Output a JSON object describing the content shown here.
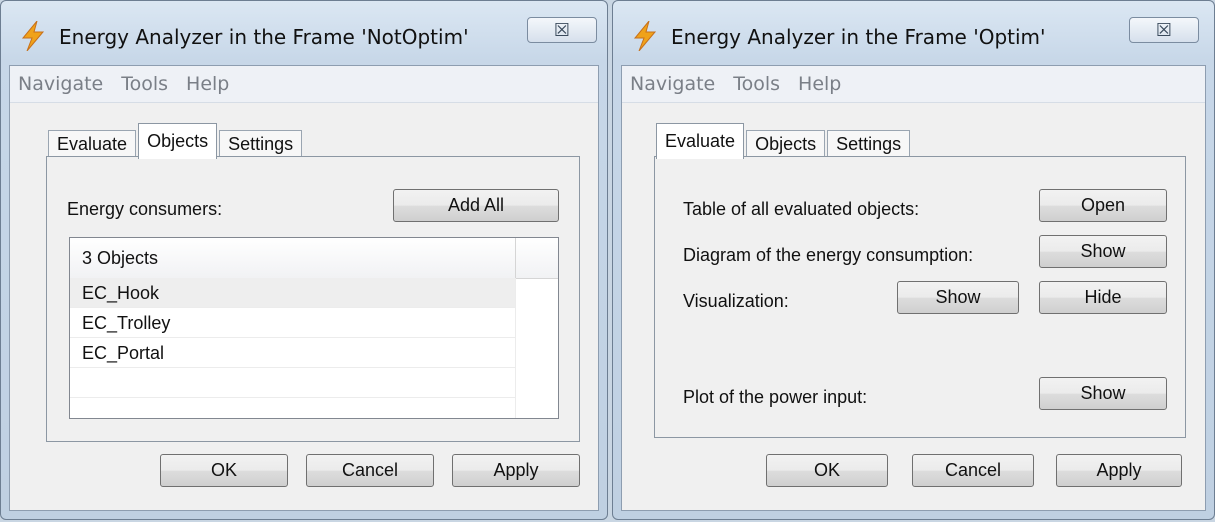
{
  "left_window": {
    "title": "Energy Analyzer in the Frame 'NotOptim'",
    "close_glyph": "☒",
    "menu": [
      "Navigate",
      "Tools",
      "Help"
    ],
    "tabs": [
      "Evaluate",
      "Objects",
      "Settings"
    ],
    "active_tab": "Objects",
    "energy_consumers_label": "Energy consumers:",
    "add_all_label": "Add All",
    "list_header": "3 Objects",
    "list_items": [
      "EC_Hook",
      "EC_Trolley",
      "EC_Portal"
    ],
    "selected_item": "EC_Hook",
    "ok_label": "OK",
    "cancel_label": "Cancel",
    "apply_label": "Apply"
  },
  "right_window": {
    "title": "Energy Analyzer in the Frame 'Optim'",
    "close_glyph": "☒",
    "menu": [
      "Navigate",
      "Tools",
      "Help"
    ],
    "tabs": [
      "Evaluate",
      "Objects",
      "Settings"
    ],
    "active_tab": "Evaluate",
    "table_label": "Table of all evaluated objects:",
    "table_button": "Open",
    "diagram_label": "Diagram of the energy consumption:",
    "diagram_button": "Show",
    "visualization_label": "Visualization:",
    "visualization_show": "Show",
    "visualization_hide": "Hide",
    "plot_label": "Plot of the power input:",
    "plot_button": "Show",
    "ok_label": "OK",
    "cancel_label": "Cancel",
    "apply_label": "Apply"
  },
  "icons": {
    "app_icon": "lightning-bolt-icon",
    "close_icon": "close-icon"
  },
  "colors": {
    "bolt_fill": "#f0a21a",
    "title_bar": "#c7d7e8",
    "menu_text_disabled": "#7a7f87"
  }
}
